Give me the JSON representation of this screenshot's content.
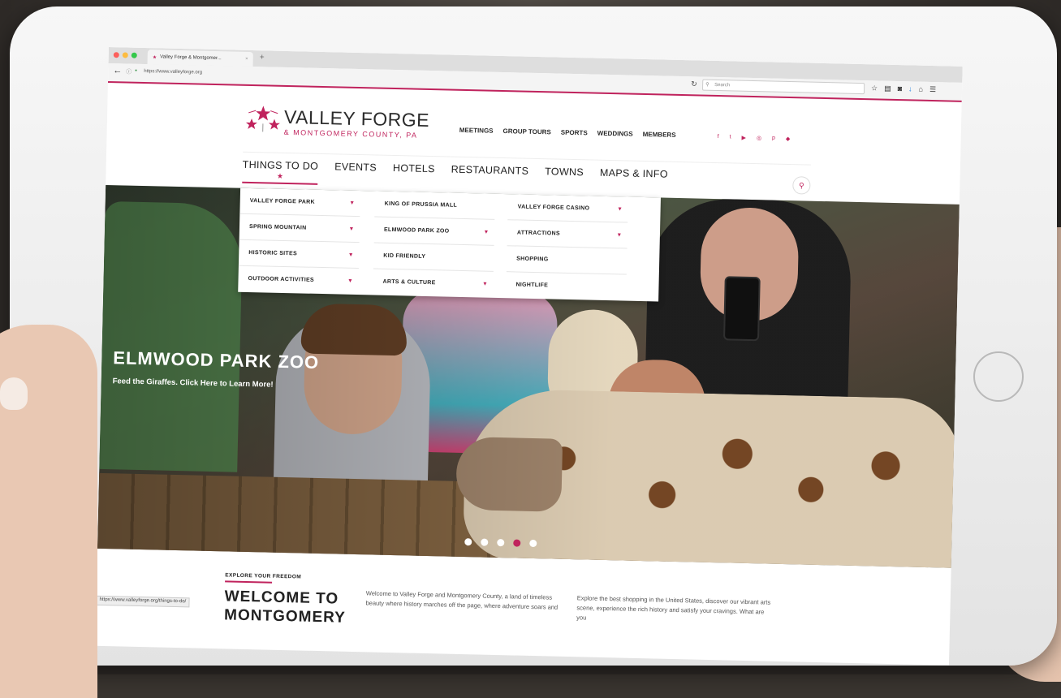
{
  "browser": {
    "tab_title": "Valley Forge & Montgomer...",
    "tab_close": "×",
    "new_tab": "+",
    "url": "https://www.valleyforge.org",
    "search_placeholder": "Search",
    "status_url": "https://www.valleyforge.org/things-to-do/"
  },
  "logo": {
    "title": "VALLEY FORGE",
    "subtitle": "& MONTGOMERY COUNTY, PA"
  },
  "top_nav": [
    "MEETINGS",
    "GROUP TOURS",
    "SPORTS",
    "WEDDINGS",
    "MEMBERS"
  ],
  "social": [
    "f",
    "t",
    "▶",
    "◎",
    "p",
    "◆"
  ],
  "main_nav": {
    "active": "THINGS TO DO",
    "items": [
      "EVENTS",
      "HOTELS",
      "RESTAURANTS",
      "TOWNS",
      "MAPS & INFO"
    ]
  },
  "dropdown": {
    "columns": [
      [
        {
          "label": "VALLEY FORGE PARK",
          "caret": "▾"
        },
        {
          "label": "SPRING MOUNTAIN",
          "caret": "▾"
        },
        {
          "label": "HISTORIC SITES",
          "caret": "▾"
        },
        {
          "label": "OUTDOOR ACTIVITIES",
          "caret": "▾"
        }
      ],
      [
        {
          "label": "KING OF PRUSSIA MALL",
          "caret": ""
        },
        {
          "label": "ELMWOOD PARK ZOO",
          "caret": "▾"
        },
        {
          "label": "KID FRIENDLY",
          "caret": ""
        },
        {
          "label": "ARTS & CULTURE",
          "caret": "▾"
        }
      ],
      [
        {
          "label": "VALLEY FORGE CASINO",
          "caret": "▾"
        },
        {
          "label": "ATTRACTIONS",
          "caret": "▾"
        },
        {
          "label": "SHOPPING",
          "caret": ""
        },
        {
          "label": "NIGHTLIFE",
          "caret": ""
        }
      ]
    ]
  },
  "hero": {
    "title": "ELMWOOD PARK ZOO",
    "subtitle": "Feed the Giraffes. Click Here to Learn More!",
    "active_slide": 4,
    "slide_count": 5
  },
  "intro": {
    "eyebrow": "EXPLORE YOUR FREEDOM",
    "heading": "WELCOME TO MONTGOMERY",
    "para1": "Welcome to Valley Forge and Montgomery County, a land of timeless beauty where history marches off the page, where adventure soars and",
    "para2": "Explore the best shopping in the United States, discover our vibrant arts scene, experience the rich history and satisfy your cravings. What are you"
  },
  "colors": {
    "accent": "#c0235d",
    "text": "#222222"
  }
}
